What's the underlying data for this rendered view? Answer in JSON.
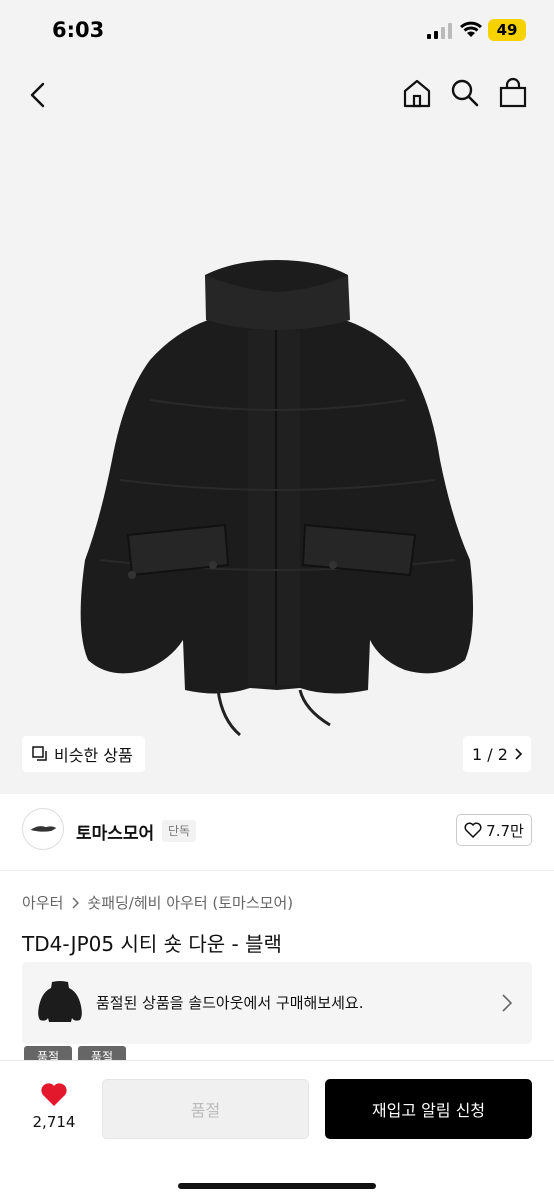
{
  "status_bar": {
    "time": "6:03",
    "battery": "49"
  },
  "gallery": {
    "similar_label": "비슷한 상품",
    "pager": "1 / 2"
  },
  "brand": {
    "name": "토마스모어",
    "tag": "단독",
    "likes": "7.7만"
  },
  "breadcrumb": {
    "level1": "아우터",
    "level2": "숏패딩/헤비 아우터 (토마스모어)"
  },
  "product": {
    "title": "TD4-JP05 시티 숏 다운 - 블랙"
  },
  "soldout_banner": {
    "text": "품절된 상품을 솔드아웃에서 구매해보세요."
  },
  "badges": [
    "품절",
    "품절"
  ],
  "bottom_bar": {
    "wish_count": "2,714",
    "soldout_button": "품절",
    "restock_button": "재입고 알림 신청"
  },
  "colors": {
    "accent": "#e3182d",
    "primary_button": "#000000"
  }
}
